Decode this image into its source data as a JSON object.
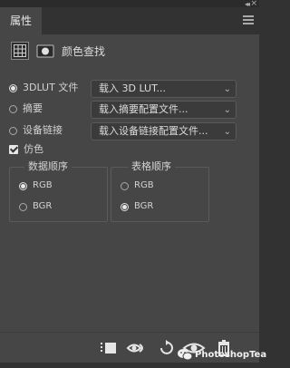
{
  "panel": {
    "tab_label": "属性",
    "collapse_glyph": "◂◂",
    "close_glyph": "×",
    "header_title": "颜色查找",
    "header_icons": [
      "adjustment-grid-icon",
      "layer-mask-icon"
    ]
  },
  "lut_rows": [
    {
      "label": "3DLUT 文件",
      "selected": true,
      "dropdown": "载入 3D LUT..."
    },
    {
      "label": "摘要",
      "selected": false,
      "dropdown": "载入摘要配置文件..."
    },
    {
      "label": "设备链接",
      "selected": false,
      "dropdown": "载入设备链接配置文件..."
    }
  ],
  "dither": {
    "label": "仿色",
    "checked": true
  },
  "data_order": {
    "title": "数据顺序",
    "options": [
      {
        "label": "RGB",
        "selected": true
      },
      {
        "label": "BGR",
        "selected": false
      }
    ]
  },
  "table_order": {
    "title": "表格顺序",
    "options": [
      {
        "label": "RGB",
        "selected": false
      },
      {
        "label": "BGR",
        "selected": true
      }
    ]
  },
  "footer_icons": [
    "clip-to-layer-icon",
    "view-previous-state-icon",
    "reset-icon",
    "toggle-visibility-icon",
    "delete-icon"
  ],
  "watermark": "PhotoshopTea",
  "colors": {
    "panel_bg": "#464646",
    "dark_bg": "#323232",
    "text": "#d2d2d2"
  }
}
